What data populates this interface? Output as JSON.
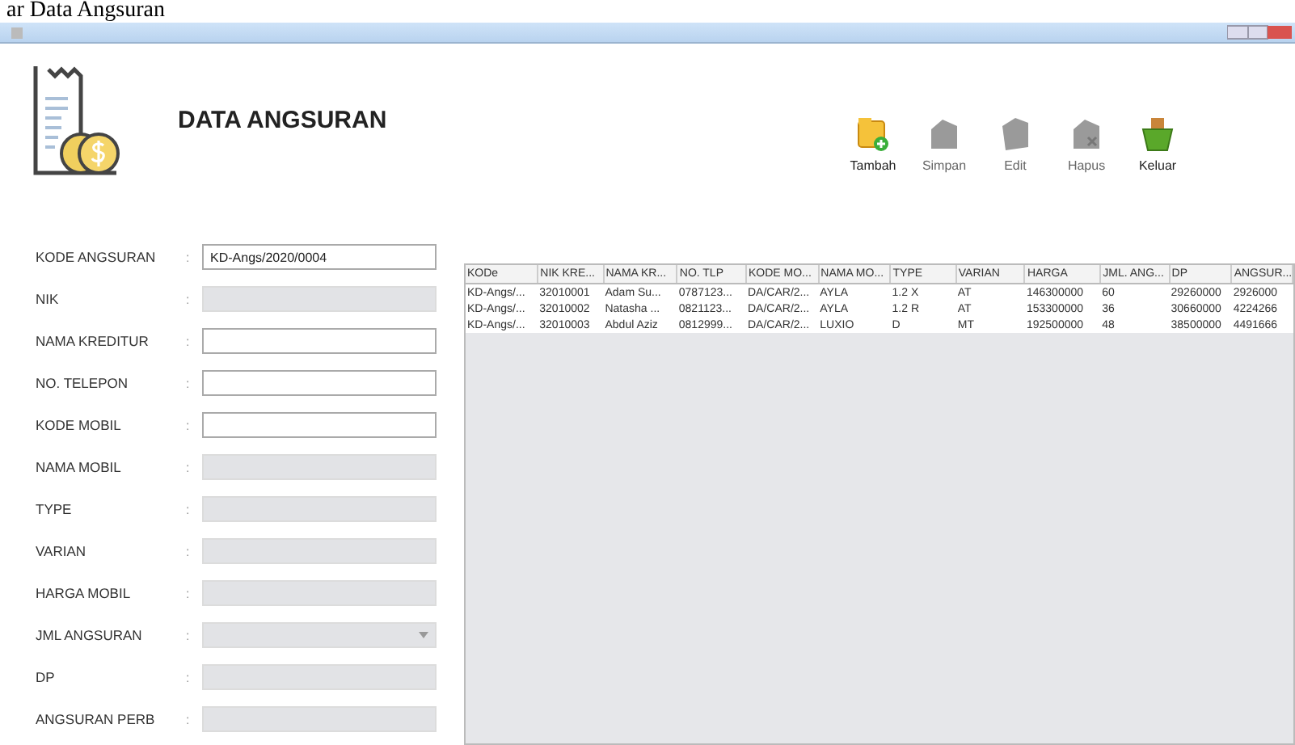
{
  "caption": "ar Data Angsuran",
  "header": {
    "title": "DATA ANGSURAN"
  },
  "toolbar": [
    {
      "label": "Tambah",
      "kind": "add",
      "disabled": false
    },
    {
      "label": "Simpan",
      "kind": "save",
      "disabled": true
    },
    {
      "label": "Edit",
      "kind": "edit",
      "disabled": true
    },
    {
      "label": "Hapus",
      "kind": "delete",
      "disabled": true
    },
    {
      "label": "Keluar",
      "kind": "exit",
      "disabled": false
    }
  ],
  "form": [
    {
      "label": "KODE ANGSURAN",
      "colon": ":",
      "value": "KD-Angs/2020/0004",
      "kind": "text",
      "disabled": false
    },
    {
      "label": "NIK",
      "colon": ":",
      "kind": "text",
      "disabled": true
    },
    {
      "label": "NAMA KREDITUR",
      "colon": ":",
      "kind": "text",
      "disabled": false
    },
    {
      "label": "NO. TELEPON",
      "colon": ":",
      "kind": "text",
      "disabled": false
    },
    {
      "label": "KODE MOBIL",
      "colon": ":",
      "kind": "text",
      "disabled": false
    },
    {
      "label": "NAMA MOBIL",
      "colon": ":",
      "kind": "text",
      "disabled": true
    },
    {
      "label": "TYPE",
      "colon": ":",
      "kind": "text",
      "disabled": true
    },
    {
      "label": "VARIAN",
      "colon": ":",
      "kind": "text",
      "disabled": true
    },
    {
      "label": "HARGA MOBIL",
      "colon": ":",
      "kind": "text",
      "disabled": true
    },
    {
      "label": "JML ANGSURAN",
      "colon": ":",
      "kind": "combo",
      "disabled": true
    },
    {
      "label": "DP",
      "colon": ":",
      "kind": "text",
      "disabled": true
    },
    {
      "label": "ANGSURAN PERB",
      "colon": ":",
      "kind": "text",
      "disabled": true
    }
  ],
  "table": {
    "columns": [
      "KODe",
      "NIK KRE...",
      "NAMA KR...",
      "NO. TLP",
      "KODE MO...",
      "NAMA MO...",
      "TYPE",
      "VARIAN",
      "HARGA",
      "JML. ANG...",
      "DP",
      "ANGSUR..."
    ],
    "rows": [
      [
        "KD-Angs/...",
        "32010001",
        "Adam Su...",
        "0787123...",
        "DA/CAR/2...",
        "AYLA",
        "1.2 X",
        "AT",
        "146300000",
        "60",
        "29260000",
        "2926000"
      ],
      [
        "KD-Angs/...",
        "32010002",
        "Natasha ...",
        "0821123...",
        "DA/CAR/2...",
        "AYLA",
        "1.2 R",
        "AT",
        "153300000",
        "36",
        "30660000",
        "4224266"
      ],
      [
        "KD-Angs/...",
        "32010003",
        "Abdul Aziz",
        "0812999...",
        "DA/CAR/2...",
        "LUXIO",
        "D",
        "MT",
        "192500000",
        "48",
        "38500000",
        "4491666"
      ]
    ]
  }
}
